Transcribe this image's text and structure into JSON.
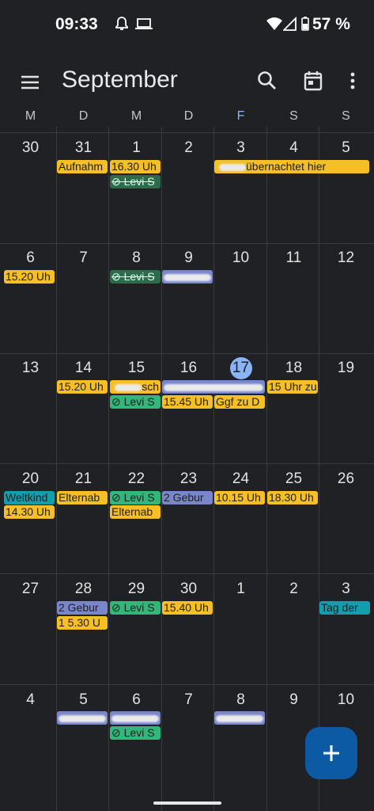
{
  "status_bar": {
    "time": "09:33",
    "battery": "57 %"
  },
  "header": {
    "title": "September"
  },
  "weekdays": [
    "M",
    "D",
    "M",
    "D",
    "F",
    "S",
    "S"
  ],
  "weeks": [
    [
      "30",
      "31",
      "1",
      "2",
      "3",
      "4",
      "5"
    ],
    [
      "6",
      "7",
      "8",
      "9",
      "10",
      "11",
      "12"
    ],
    [
      "13",
      "14",
      "15",
      "16",
      "17",
      "18",
      "19"
    ],
    [
      "20",
      "21",
      "22",
      "23",
      "24",
      "25",
      "26"
    ],
    [
      "27",
      "28",
      "29",
      "30",
      "1",
      "2",
      "3"
    ],
    [
      "4",
      "5",
      "6",
      "7",
      "8",
      "9",
      "10"
    ]
  ],
  "today_label": "17",
  "events": {
    "w0_tue": "Aufnahm",
    "w0_wed": "16.30 Uh",
    "w0_wed_task": "⊘ Levi S",
    "w0_fri": "übernachtet hier",
    "w1_mon": "15.20 Uh",
    "w1_wed_task": "⊘ Levi S",
    "w2_tue": "15.20 Uh",
    "w2_wed": "sch",
    "w2_wed_task": "⊘ Levi S",
    "w2_thu2": "15.45 Uh",
    "w2_fri2": "Ggf zu D",
    "w2_sat": "15 Uhr zu",
    "w3_mon": "Weltkind",
    "w3_mon2": "14.30 Uh",
    "w3_tue": "Elternab",
    "w3_wed_task": "⊘ Levi S",
    "w3_wed2": "Elternab",
    "w3_thu": "2 Gebur",
    "w3_fri": "10.15 Uh",
    "w3_sat": "18.30 Uh",
    "w4_tue": "2 Gebur",
    "w4_tue2": "1 5.30 U",
    "w4_wed_task": "⊘ Levi S",
    "w4_thu": "15.40 Uh",
    "w4_sun": "Tag der",
    "w5_wed_task": "⊘ Levi S"
  }
}
